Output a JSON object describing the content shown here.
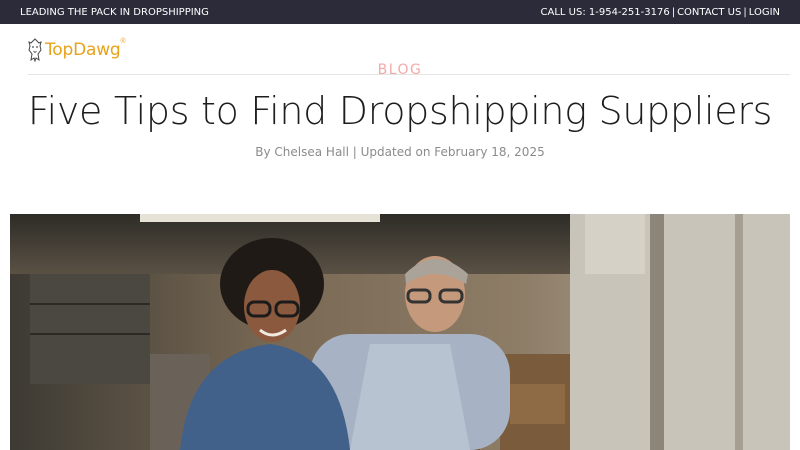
{
  "topbar": {
    "tagline": "LEADING THE PACK IN DROPSHIPPING",
    "call_us": "CALL US: 1-954-251-3176",
    "separator": "|",
    "contact_us": "CONTACT US",
    "login": "LOGIN",
    "bg_color": "#2b2b3a"
  },
  "header": {
    "logo_text": "TopDawg",
    "logo_reg": "®",
    "logo_color": "#e8a21a"
  },
  "article": {
    "category": "BLOG",
    "title": "Five Tips to Find Dropshipping Suppliers",
    "byline": "By Chelsea Hall | Updated on February 18, 2025"
  },
  "hero_image": {
    "icon": "photo",
    "subject": "two smiling people in a warehouse"
  }
}
